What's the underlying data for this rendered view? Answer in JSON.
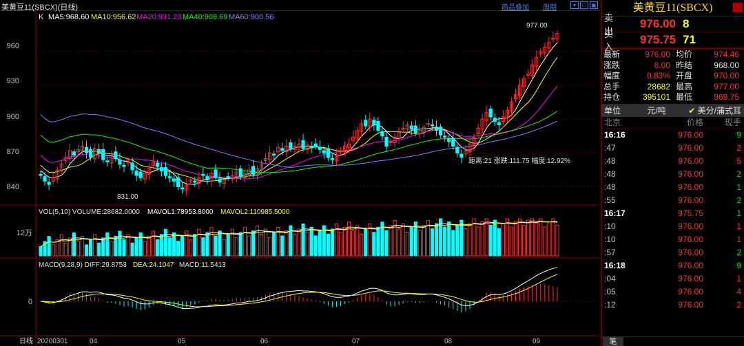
{
  "topbar": {
    "title": "美黄豆11(SBCX)(日线)",
    "btn_overlay": "商品叠加",
    "btn_period": "周期"
  },
  "indicators": {
    "k_label": "K",
    "ma5": "MA5:968.60",
    "ma10": "MA10:956.62",
    "ma20": "MA20:931.23",
    "ma40": "MA40:909.69",
    "ma60": "MA60:900.56",
    "high_tag": "977.00",
    "low_tag": "831.00",
    "range_info": "距离:21  涨跌:111.75  幅度:12.92%",
    "vol_line": "VOL(5,10) VOLUME:28682.0000",
    "mavol1": "MAVOL1:78953.8000",
    "mavol2": "MAVOL2:110985.5000",
    "vol_axis": "12万",
    "macd_line": "MACD(9,28,9) DIFF:29.8753",
    "dea": "DEA:24.1047",
    "macd_val": "MACD:11.5413",
    "macd_axis": "0",
    "price_axis": [
      "960",
      "930",
      "900",
      "870",
      "840"
    ],
    "xaxis_label": "日线",
    "x_dates": [
      "20200301",
      "04",
      "05",
      "06",
      "07",
      "08",
      "09"
    ]
  },
  "colors": {
    "up": "#ff3030",
    "down": "#00ffff",
    "ma5": "#ffffff",
    "ma10": "#ffff00",
    "ma20": "#ff00ff",
    "ma40": "#00ff00",
    "ma60": "#8080ff"
  },
  "chart_data": {
    "type": "candlestick",
    "ylim": [
      825,
      985
    ],
    "closes": [
      850,
      845,
      842,
      848,
      855,
      860,
      866,
      872,
      868,
      873,
      876,
      870,
      866,
      874,
      870,
      864,
      862,
      868,
      865,
      860,
      858,
      862,
      855,
      850,
      848,
      852,
      856,
      862,
      858,
      854,
      850,
      848,
      845,
      840,
      838,
      842,
      846,
      844,
      848,
      850,
      846,
      852,
      848,
      844,
      846,
      848,
      850,
      853,
      849,
      852,
      855,
      851,
      856,
      860,
      865,
      870,
      868,
      875,
      872,
      876,
      874,
      876,
      878,
      874,
      877,
      875,
      876,
      873,
      870,
      866,
      864,
      868,
      872,
      876,
      878,
      884,
      890,
      896,
      894,
      900,
      895,
      890,
      885,
      876,
      880,
      884,
      888,
      892,
      895,
      891,
      888,
      890,
      893,
      896,
      894,
      890,
      886,
      884,
      880,
      876,
      870,
      866,
      872,
      878,
      884,
      892,
      900,
      906,
      902,
      898,
      895,
      902,
      908,
      915,
      922,
      930,
      936,
      940,
      948,
      955,
      960,
      964,
      968,
      972,
      976
    ]
  },
  "panel": {
    "symbol": "美黄豆11(SBCX)",
    "sell_label": "卖出",
    "sell_price": "976.00",
    "sell_qty": "8",
    "buy_label": "买入",
    "buy_price": "975.75",
    "buy_qty": "71",
    "stats": [
      {
        "k": "最新",
        "v": "976.00",
        "k2": "均价",
        "v2": "974.46"
      },
      {
        "k": "涨跌",
        "v": "8.00",
        "k2": "昨结",
        "v2": "968.00"
      },
      {
        "k": "幅度",
        "v": "0.83%",
        "k2": "开盘",
        "v2": "970.00"
      },
      {
        "k": "总手",
        "v": "28682",
        "k2": "最高",
        "v2": "977.00"
      },
      {
        "k": "持仓",
        "v": "395101",
        "k2": "最低",
        "v2": "969.75"
      }
    ],
    "unit_label": "单位",
    "unit_value": "元/吨",
    "unit_check": "✔",
    "unit_alt": "美分/蒲式耳",
    "th_loc": "北京",
    "th_price": "价格",
    "th_qty": "现手",
    "ticks": [
      {
        "t": "16:16",
        "p": "976.00",
        "q": "9",
        "strong": true,
        "c": "g"
      },
      {
        "t": ":47",
        "p": "976.00",
        "q": "2",
        "c": "r"
      },
      {
        "t": ":48",
        "p": "976.00",
        "q": "5",
        "c": "r"
      },
      {
        "t": ":48",
        "p": "976.00",
        "q": "2",
        "c": "g"
      },
      {
        "t": ":48",
        "p": "976.00",
        "q": "1",
        "c": "g"
      },
      {
        "t": ":55",
        "p": "976.00",
        "q": "2",
        "c": "g"
      },
      {
        "t": "16:17",
        "p": "975.75",
        "q": "1",
        "strong": true,
        "c": "g"
      },
      {
        "t": ":10",
        "p": "976.00",
        "q": "1",
        "c": "r"
      },
      {
        "t": ":10",
        "p": "976.00",
        "q": "1",
        "c": "r"
      },
      {
        "t": ":57",
        "p": "976.00",
        "q": "2",
        "c": "g"
      },
      {
        "t": "16:18",
        "p": "976.00",
        "q": "9",
        "strong": true,
        "c": "g"
      },
      {
        "t": ":04",
        "p": "976.00",
        "q": "1",
        "c": "r"
      },
      {
        "t": ":05",
        "p": "976.00",
        "q": "4",
        "c": "r"
      },
      {
        "t": ":12",
        "p": "976.00",
        "q": "2",
        "c": "r"
      }
    ],
    "footer_tab": "笔"
  }
}
